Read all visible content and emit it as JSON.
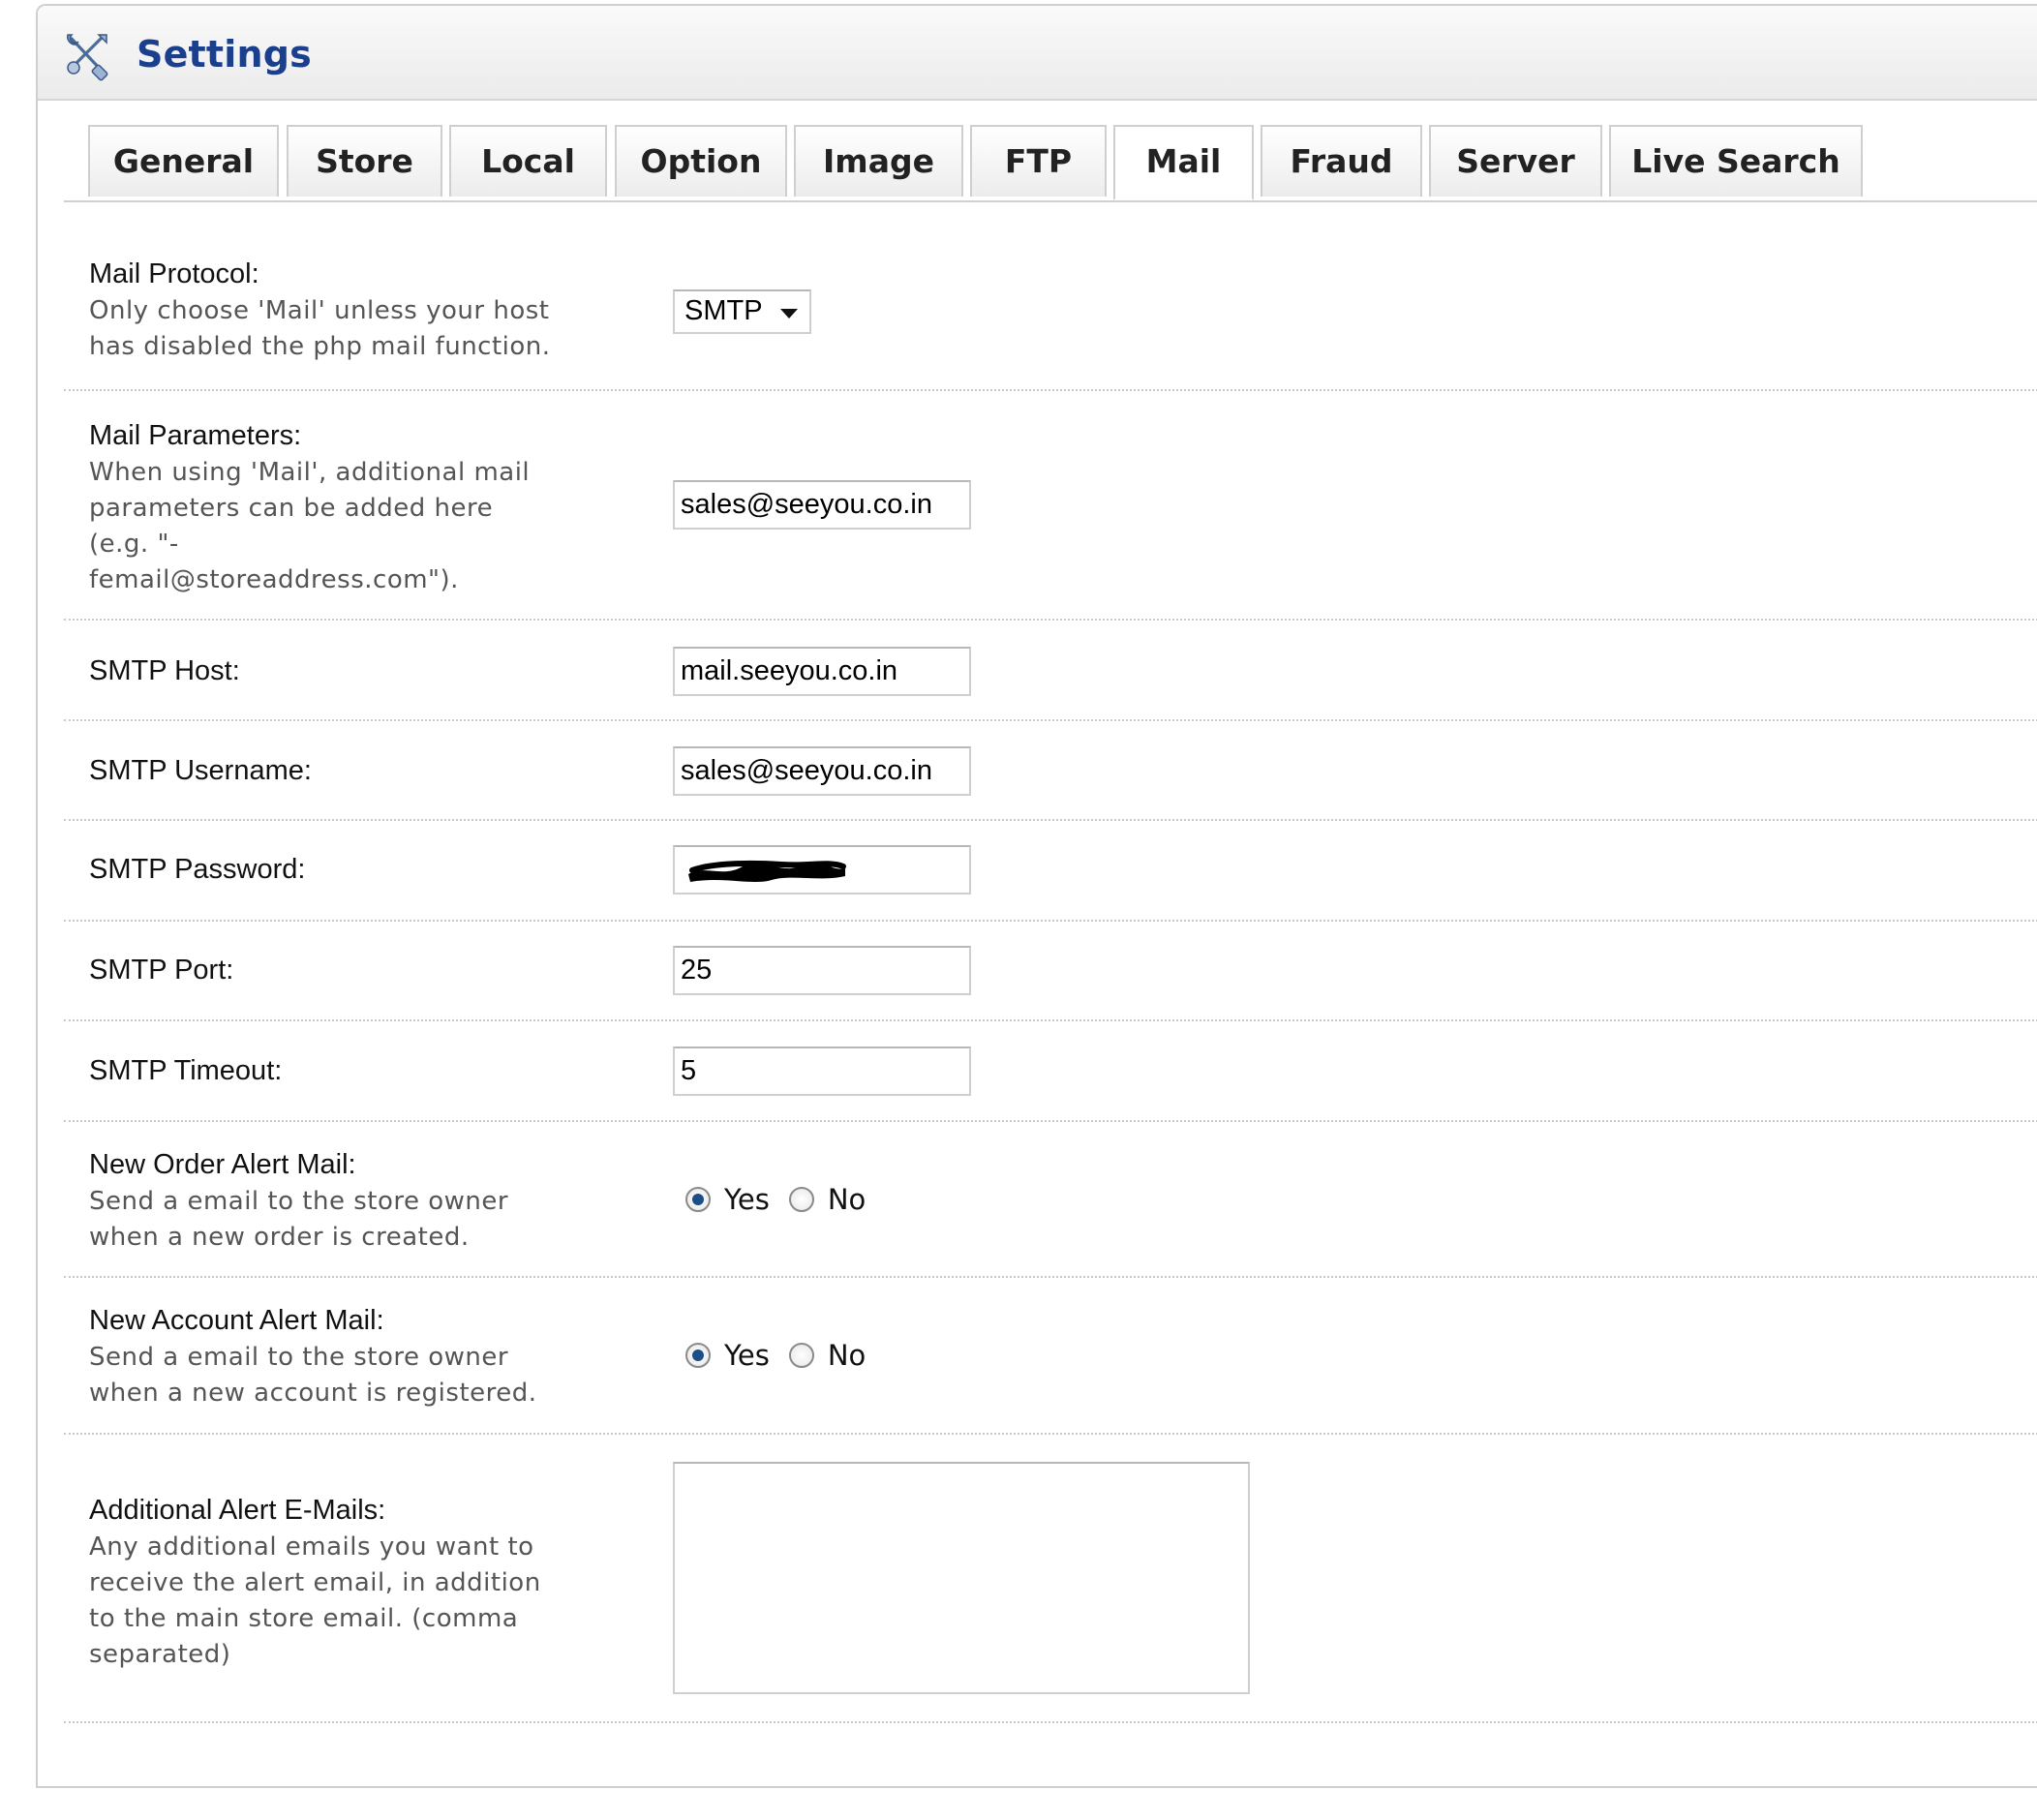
{
  "header": {
    "title": "Settings",
    "icon": "tools-icon"
  },
  "tabs": [
    {
      "label": "General",
      "active": false
    },
    {
      "label": "Store",
      "active": false
    },
    {
      "label": "Local",
      "active": false
    },
    {
      "label": "Option",
      "active": false
    },
    {
      "label": "Image",
      "active": false
    },
    {
      "label": "FTP",
      "active": false
    },
    {
      "label": "Mail",
      "active": true
    },
    {
      "label": "Fraud",
      "active": false
    },
    {
      "label": "Server",
      "active": false
    },
    {
      "label": "Live Search",
      "active": false
    }
  ],
  "form": {
    "mail_protocol": {
      "label": "Mail Protocol:",
      "help": "Only choose 'Mail' unless your host has disabled the php mail function.",
      "value": "SMTP"
    },
    "mail_parameters": {
      "label": "Mail Parameters:",
      "help": "When using 'Mail', additional mail parameters can be added here (e.g. \"-femail@storeaddress.com\").",
      "value": "sales@seeyou.co.in"
    },
    "smtp_host": {
      "label": "SMTP Host:",
      "value": "mail.seeyou.co.in"
    },
    "smtp_username": {
      "label": "SMTP Username:",
      "value": "sales@seeyou.co.in"
    },
    "smtp_password": {
      "label": "SMTP Password:",
      "value": ""
    },
    "smtp_port": {
      "label": "SMTP Port:",
      "value": "25"
    },
    "smtp_timeout": {
      "label": "SMTP Timeout:",
      "value": "5"
    },
    "new_order_alert": {
      "label": "New Order Alert Mail:",
      "help": "Send a email to the store owner when a new order is created.",
      "yes_label": "Yes",
      "no_label": "No",
      "selected": "Yes"
    },
    "new_account_alert": {
      "label": "New Account Alert Mail:",
      "help": "Send a email to the store owner when a new account is registered.",
      "yes_label": "Yes",
      "no_label": "No",
      "selected": "Yes"
    },
    "additional_alert_emails": {
      "label": "Additional Alert E-Mails:",
      "help": "Any additional emails you want to receive the alert email, in addition to the main store email. (comma separated)",
      "value": ""
    }
  },
  "colors": {
    "title": "#1a3f8c",
    "radio_checked": "#1c4f86"
  }
}
